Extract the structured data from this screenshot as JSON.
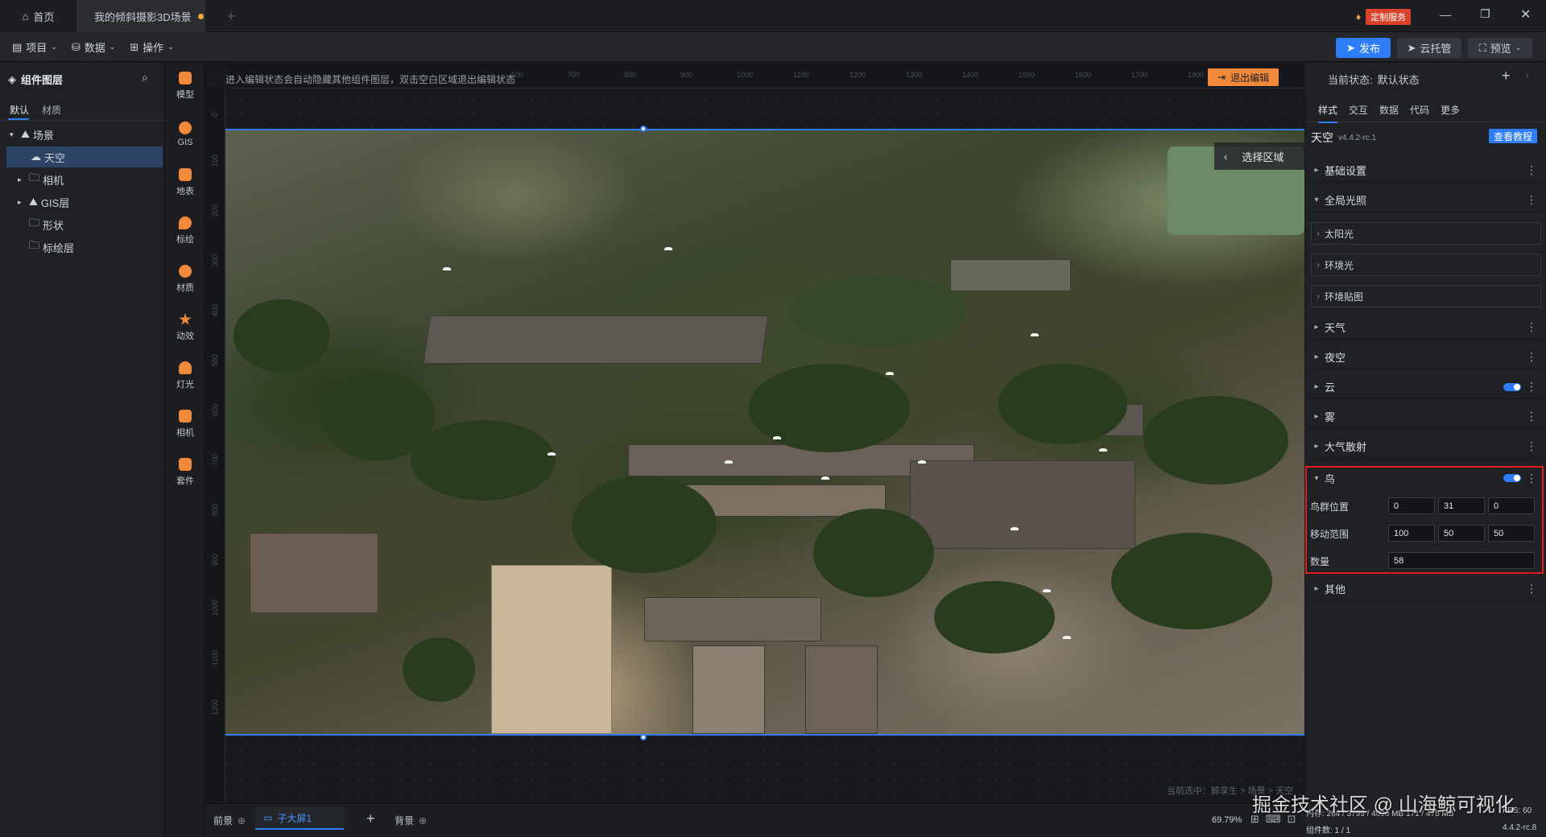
{
  "titlebar": {
    "home": "首页",
    "doc_tab": "我的倾斜摄影3D场景",
    "custom_service": "定制服务"
  },
  "toolbar": {
    "project": "项目",
    "data": "数据",
    "operate": "操作",
    "publish": "发布",
    "cloud": "云托管",
    "preview": "预览"
  },
  "left": {
    "title": "组件图层",
    "tabs": [
      "默认",
      "材质"
    ],
    "tree": [
      {
        "label": "场景",
        "depth": 0
      },
      {
        "label": "天空",
        "depth": 1,
        "selected": true
      },
      {
        "label": "相机",
        "depth": 1
      },
      {
        "label": "GIS层",
        "depth": 1
      },
      {
        "label": "形状",
        "depth": 1
      },
      {
        "label": "标绘层",
        "depth": 1
      }
    ]
  },
  "iconbar": [
    "模型",
    "GIS",
    "地表",
    "标绘",
    "材质",
    "动效",
    "灯光",
    "相机",
    "套件"
  ],
  "canvas": {
    "hint": "进入编辑状态会自动隐藏其他组件图层，双击空白区域退出编辑状态",
    "exit_btn": "退出编辑",
    "select_region": "选择区域",
    "current_selection": "当前选中：鲸孪生 > 场景 > 天空",
    "ruler_top": [
      "600",
      "700",
      "800",
      "900",
      "1000",
      "1100",
      "1200",
      "1300",
      "1400",
      "1500",
      "1600",
      "1700",
      "1800",
      "1900"
    ],
    "ruler_left": [
      "0",
      "100",
      "200",
      "300",
      "400",
      "500",
      "600",
      "700",
      "800",
      "900",
      "1000",
      "1100",
      "1200"
    ]
  },
  "bottom": {
    "foreground": "前景",
    "screen_tab": "子大屏1",
    "background": "背景",
    "zoom": "69.79%",
    "stats_line1": "内存: 264 / 3799 / 4096 MB  171 / 475 MB",
    "stats_line2": "组件数: 1 / 1",
    "fps": "FPS: 60",
    "version": "4.4.2-rc.8",
    "watermark": "掘金技术社区 @ 山海鲸可视化"
  },
  "right": {
    "state_label": "当前状态:",
    "state_value": "默认状态",
    "tabs": [
      "样式",
      "交互",
      "数据",
      "代码",
      "更多"
    ],
    "comp_name": "天空",
    "comp_version": "v4.4.2-rc.1",
    "tutorial": "查看教程",
    "sections": [
      "基础设置",
      "全局光照"
    ],
    "subsections": [
      "太阳光",
      "环境光",
      "环境贴图"
    ],
    "sections2": [
      "天气",
      "夜空",
      "云",
      "雾",
      "大气散射"
    ],
    "bird": {
      "title": "鸟",
      "pos_label": "鸟群位置",
      "pos": [
        "0",
        "31",
        "0"
      ],
      "range_label": "移动范围",
      "range": [
        "100",
        "50",
        "50"
      ],
      "count_label": "数量",
      "count": "58"
    },
    "other": "其他"
  },
  "colors": {
    "accent": "#2f7df6",
    "highlight": "#e01e1e",
    "orange": "#f08a3a"
  }
}
